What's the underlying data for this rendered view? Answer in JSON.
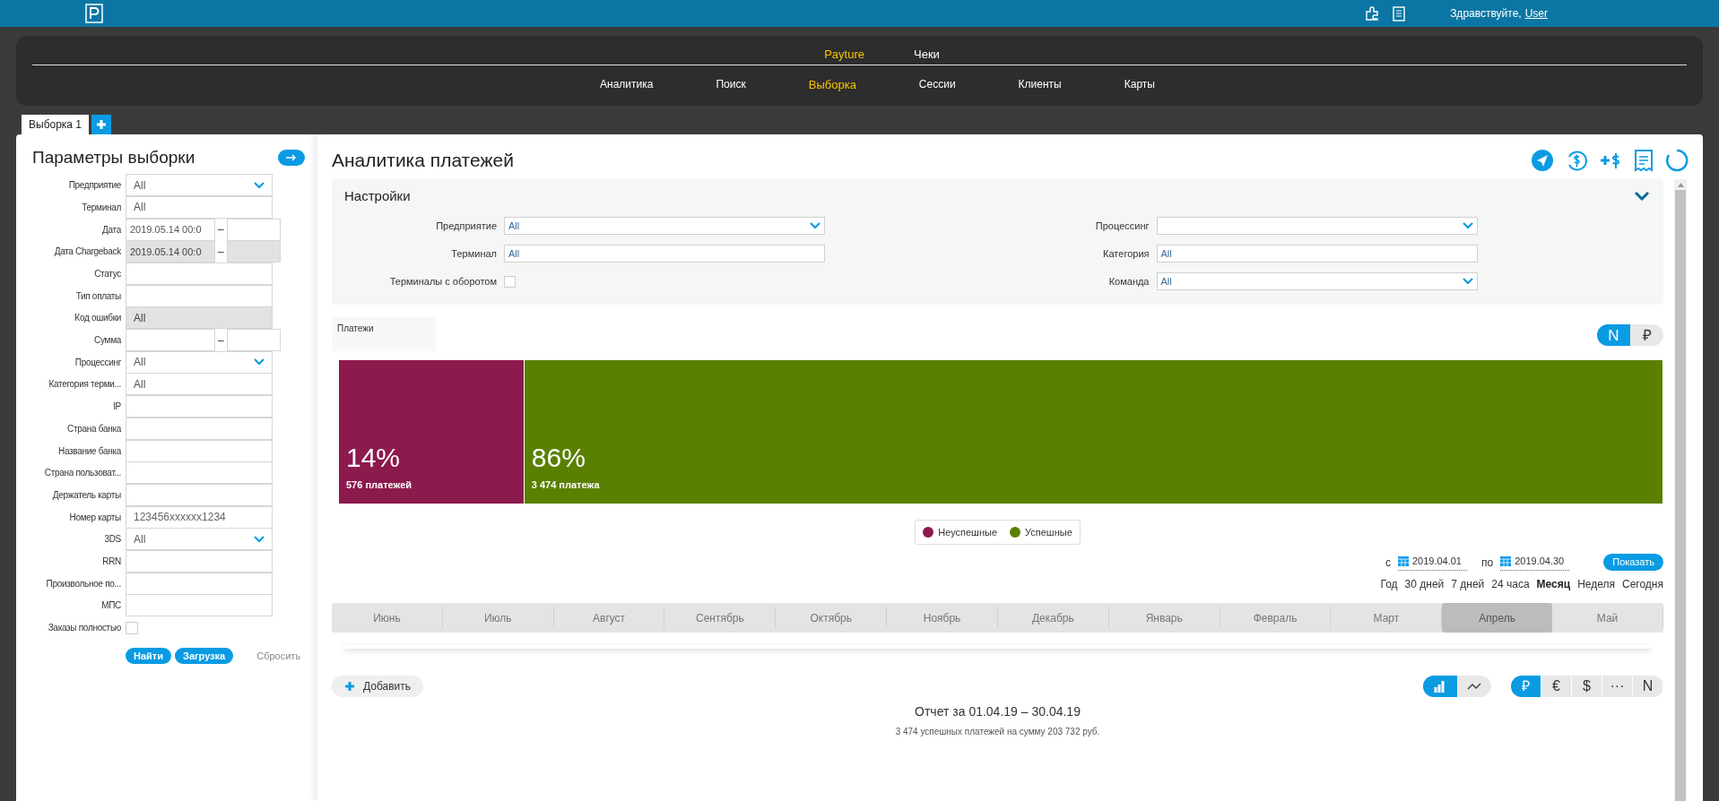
{
  "header": {
    "greeting": "Здравствуйте,",
    "user": "User"
  },
  "nav": {
    "top": [
      {
        "label": "Payture",
        "selected": true
      },
      {
        "label": "Чеки",
        "selected": false
      }
    ],
    "sub": [
      {
        "label": "Аналитика",
        "selected": false
      },
      {
        "label": "Поиск",
        "selected": false
      },
      {
        "label": "Выборка",
        "selected": true
      },
      {
        "label": "Сессии",
        "selected": false
      },
      {
        "label": "Клиенты",
        "selected": false
      },
      {
        "label": "Карты",
        "selected": false
      }
    ]
  },
  "tabs": [
    {
      "label": "Выборка 1",
      "selected": true
    }
  ],
  "filter": {
    "title": "Параметры выборки",
    "fields": [
      {
        "label": "Предприятие",
        "kind": "select",
        "value": "All",
        "disabled": false
      },
      {
        "label": "Терминал",
        "kind": "input",
        "value": "All",
        "disabled": false
      },
      {
        "label": "Дата",
        "kind": "range",
        "value": "2019.05.14 00:0",
        "separator": "–",
        "disabled": false
      },
      {
        "label": "Дата Chargeback",
        "kind": "range",
        "value": "2019.05.14 00:0",
        "separator": "–",
        "disabled": true
      },
      {
        "label": "Статус",
        "kind": "input",
        "disabled": false
      },
      {
        "label": "Тип оплаты",
        "kind": "input",
        "disabled": false
      },
      {
        "label": "Код ошибки",
        "kind": "input",
        "value": "All",
        "disabled": true
      },
      {
        "label": "Сумма",
        "kind": "range",
        "separator": "–",
        "disabled": false
      },
      {
        "label": "Процессинг",
        "kind": "select",
        "value": "All",
        "disabled": false
      },
      {
        "label": "Категория терми...",
        "kind": "input",
        "value": "All",
        "disabled": false
      },
      {
        "label": "IP",
        "kind": "input",
        "disabled": false
      },
      {
        "label": "Страна банка",
        "kind": "input",
        "disabled": false
      },
      {
        "label": "Название банка",
        "kind": "input",
        "disabled": false
      },
      {
        "label": "Страна пользоват...",
        "kind": "input",
        "disabled": false
      },
      {
        "label": "Держатель карты",
        "kind": "input",
        "disabled": false
      },
      {
        "label": "Номер карты",
        "kind": "input",
        "placeholder": "123456xxxxxx1234",
        "disabled": false
      },
      {
        "label": "3DS",
        "kind": "select",
        "value": "All",
        "disabled": false
      },
      {
        "label": "RRN",
        "kind": "input",
        "disabled": false
      },
      {
        "label": "Произвольное по...",
        "kind": "input",
        "disabled": false
      },
      {
        "label": "МПС",
        "kind": "input",
        "disabled": false
      },
      {
        "label": "Заказы полностью",
        "kind": "checkbox",
        "checked": false,
        "disabled": false
      }
    ],
    "buttons": [
      "Найти",
      "Загрузка"
    ],
    "reset": "Сбросить"
  },
  "analytics": {
    "title": "Аналитика платежей",
    "settings": {
      "title": "Настройки",
      "expanded": true,
      "fields": [
        {
          "label": "Предприятие",
          "kind": "select",
          "value": "All"
        },
        {
          "label": "Процессинг",
          "kind": "select"
        },
        {
          "label": "Терминал",
          "kind": "input",
          "value": "All"
        },
        {
          "label": "Категория",
          "kind": "input",
          "value": "All"
        },
        {
          "label": "Терминалы с оборотом",
          "kind": "checkbox",
          "checked": false
        },
        {
          "label": "Команда",
          "kind": "select",
          "value": "All"
        }
      ]
    },
    "metric": "Платежи",
    "mode_toggle": [
      {
        "label": "N",
        "selected": true
      },
      {
        "label": "₽",
        "selected": false
      }
    ],
    "segments": [
      {
        "name": "Неуспешные",
        "percent": "14%",
        "count": "576 платежей",
        "level": 0.14,
        "color": "#8c1a4c"
      },
      {
        "name": "Успешные",
        "percent": "86%",
        "count": "3 474 платежа",
        "level": 0.86,
        "color": "#5a8000"
      }
    ],
    "range": {
      "from_label": "с",
      "from": "2019.04.01",
      "to_label": "по",
      "to": "2019.04.30",
      "button": "Показать"
    },
    "periods": [
      {
        "label": "Год",
        "selected": false
      },
      {
        "label": "30 дней",
        "selected": false
      },
      {
        "label": "7 дней",
        "selected": false
      },
      {
        "label": "24 часа",
        "selected": false
      },
      {
        "label": "Месяц",
        "selected": true
      },
      {
        "label": "Неделя",
        "selected": false
      },
      {
        "label": "Сегодня",
        "selected": false
      }
    ],
    "months": [
      {
        "label": "Июнь",
        "selected": false
      },
      {
        "label": "Июль",
        "selected": false
      },
      {
        "label": "Август",
        "selected": false
      },
      {
        "label": "Сентябрь",
        "selected": false
      },
      {
        "label": "Октябрь",
        "selected": false
      },
      {
        "label": "Ноябрь",
        "selected": false
      },
      {
        "label": "Декабрь",
        "selected": false
      },
      {
        "label": "Январь",
        "selected": false
      },
      {
        "label": "Февраль",
        "selected": false
      },
      {
        "label": "Март",
        "selected": false
      },
      {
        "label": "Апрель",
        "selected": true
      },
      {
        "label": "Май",
        "selected": false
      }
    ],
    "add": "Добавить",
    "chart_types": [
      {
        "kind": "bar",
        "selected": true
      },
      {
        "kind": "line",
        "selected": false
      }
    ],
    "currencies": [
      {
        "label": "₽",
        "selected": true
      },
      {
        "label": "€",
        "selected": false
      },
      {
        "label": "$",
        "selected": false
      },
      {
        "label": "···",
        "selected": false
      },
      {
        "label": "N",
        "selected": false
      }
    ],
    "report_title": "Отчет за 01.04.19 – 30.04.19",
    "report_summary": "3 474 успешных платежей на сумму 203 732 руб."
  }
}
